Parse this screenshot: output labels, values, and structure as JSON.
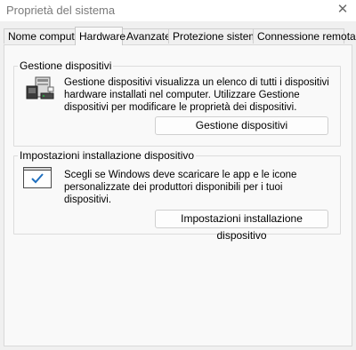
{
  "window": {
    "title": "Proprietà del sistema"
  },
  "tabs": [
    {
      "label": "Nome computer"
    },
    {
      "label": "Hardware"
    },
    {
      "label": "Avanzate"
    },
    {
      "label": "Protezione sistema"
    },
    {
      "label": "Connessione remota"
    }
  ],
  "device_manager": {
    "group_label": "Gestione dispositivi",
    "description": "Gestione dispositivi visualizza un elenco di tutti i dispositivi hardware installati nel computer. Utilizzare Gestione dispositivi per modificare le proprietà dei dispositivi.",
    "button_label": "Gestione dispositivi",
    "icon": "device-manager-icon"
  },
  "device_install": {
    "group_label": "Impostazioni installazione dispositivo",
    "description": "Scegli se Windows deve scaricare le app e le icone personalizzate dei produttori disponibili per i tuoi dispositivi.",
    "button_label": "Impostazioni installazione dispositivo",
    "icon": "checkbox-window-icon"
  }
}
